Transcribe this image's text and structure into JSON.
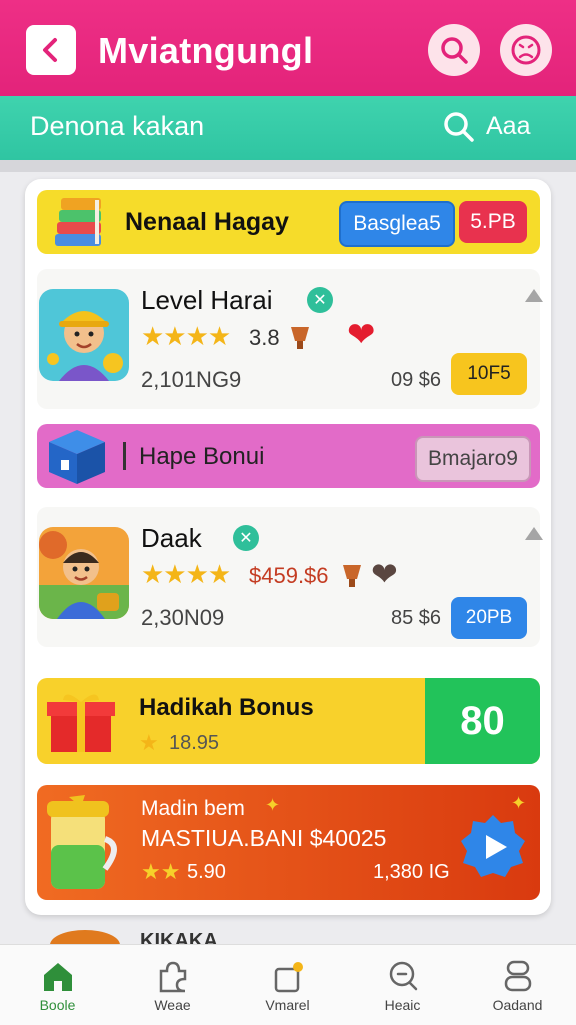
{
  "header": {
    "title": "Mviatngungl",
    "back_icon": "chevron-left-icon",
    "search_icon": "search-icon",
    "profile_icon": "sad-face-icon"
  },
  "subheader": {
    "title": "Denona kakan",
    "search_label": "Aaa"
  },
  "promo_top": {
    "title": "Nenaal Hagay",
    "button1": "Basglea5",
    "button2": "5.PB"
  },
  "games": [
    {
      "name": "Level Harai",
      "rating": "3.8",
      "downloads": "2,101NG9",
      "price": "09 $6",
      "action": "10F5"
    },
    {
      "name": "Daak",
      "rating": "$459.$6",
      "downloads": "2,30N09",
      "price": "85 $6",
      "action": "20PB"
    }
  ],
  "pink_banner": {
    "title": "Hape Bonui",
    "button": "Bmajaro9"
  },
  "hadikah": {
    "title": "Hadikah Bonus",
    "sub": "18.95",
    "value": "80"
  },
  "madin": {
    "line1": "Madin bem",
    "line2": "MASTIUA.BANI $40025",
    "stars_text": "5.90",
    "count": "1,380 IG"
  },
  "bottom_peek": "KIKAKA",
  "nav": [
    {
      "label": "Boole",
      "icon": "home-icon"
    },
    {
      "label": "Weae",
      "icon": "puzzle-icon"
    },
    {
      "label": "Vmarel",
      "icon": "bag-icon"
    },
    {
      "label": "Heaic",
      "icon": "search-icon"
    },
    {
      "label": "Oadand",
      "icon": "profile-icon"
    }
  ],
  "colors": {
    "header": "#e3237a",
    "subheader": "#2fc5a2",
    "banner_yellow": "#f6dc2a",
    "banner_pink": "#e26bc8",
    "blue": "#2f86e8",
    "red": "#e8324e",
    "green": "#22c35a",
    "orange": "#e85418"
  }
}
